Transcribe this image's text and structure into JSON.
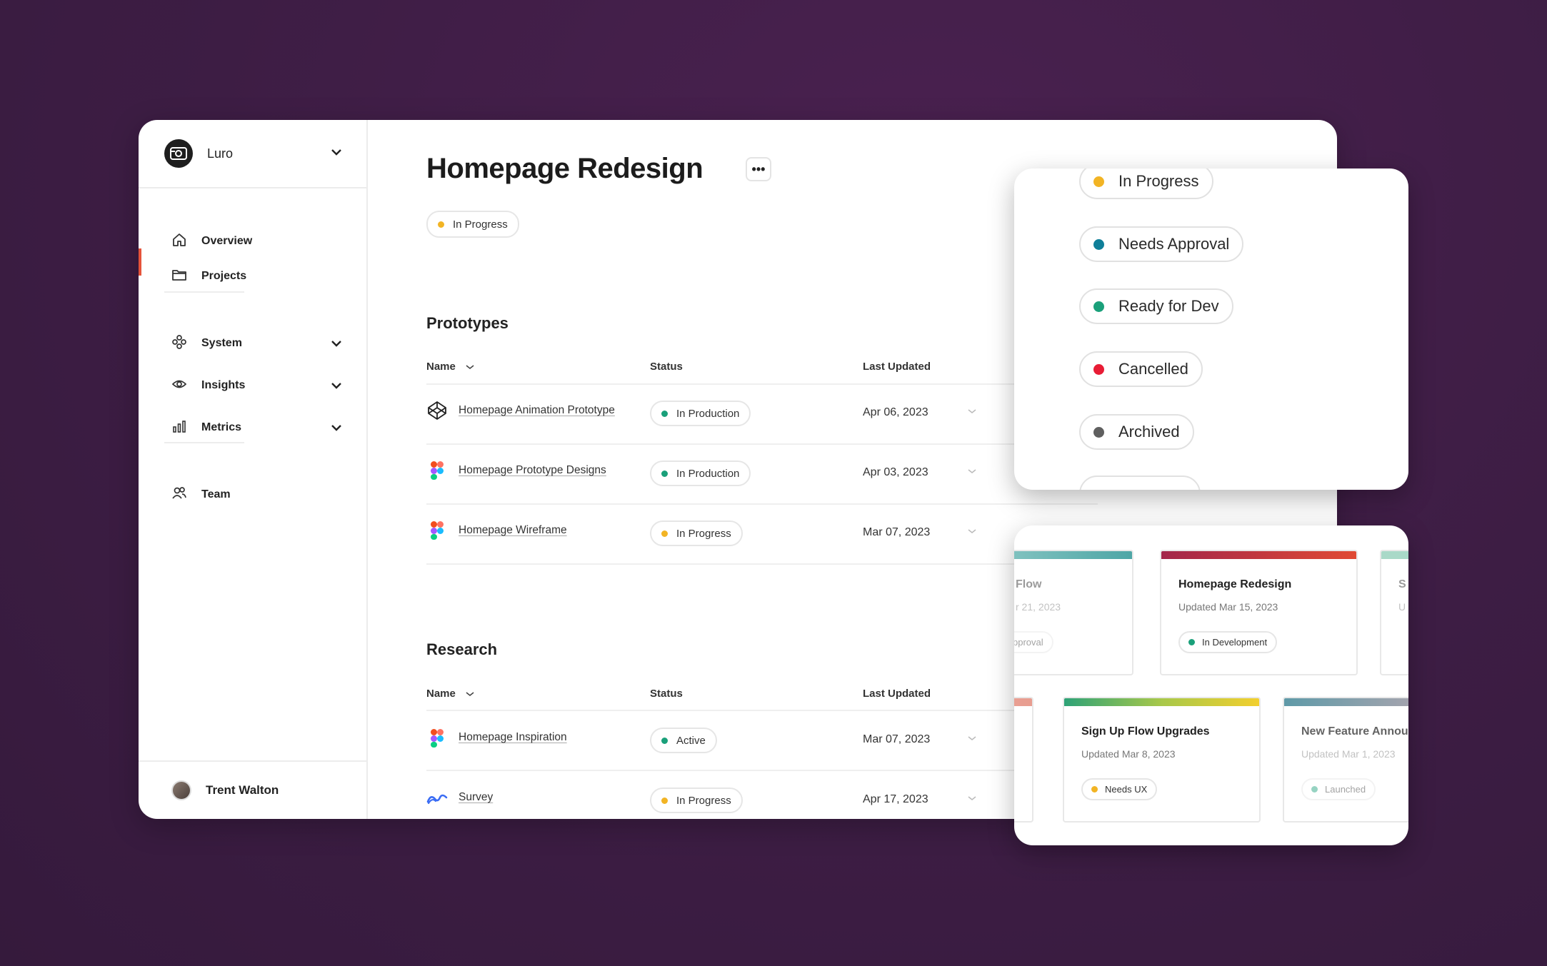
{
  "workspace": {
    "name": "Luro"
  },
  "nav": {
    "items": [
      {
        "label": "Overview",
        "icon": "home-icon"
      },
      {
        "label": "Projects",
        "icon": "folder-icon",
        "active": true
      },
      {
        "label": "System",
        "icon": "components-icon"
      },
      {
        "label": "Insights",
        "icon": "eye-icon"
      },
      {
        "label": "Metrics",
        "icon": "bar-chart-icon"
      },
      {
        "label": "Team",
        "icon": "users-icon"
      }
    ]
  },
  "user": {
    "name": "Trent Walton"
  },
  "page": {
    "title": "Homepage Redesign",
    "more": "•••",
    "status": "In Progress"
  },
  "columns": {
    "name": "Name",
    "status": "Status",
    "updated": "Last Updated"
  },
  "prototypes": {
    "title": "Prototypes",
    "rows": [
      {
        "name": "Homepage Animation Prototype",
        "status": "In Production",
        "date": "Apr 06, 2023",
        "icon": "codepen-icon"
      },
      {
        "name": "Homepage Prototype Designs",
        "status": "In Production",
        "date": "Apr 03, 2023",
        "icon": "figma-icon"
      },
      {
        "name": "Homepage Wireframe",
        "status": "In Progress",
        "date": "Mar 07, 2023",
        "icon": "figma-icon"
      }
    ]
  },
  "research": {
    "title": "Research",
    "rows": [
      {
        "name": "Homepage Inspiration",
        "status": "Active",
        "date": "Mar 07, 2023",
        "icon": "figma-icon"
      },
      {
        "name": "Survey",
        "status": "In Progress",
        "date": "Apr 17, 2023",
        "icon": "survey-icon"
      }
    ]
  },
  "status_options": [
    {
      "label": "In Progress",
      "color": "#f2b424"
    },
    {
      "label": "Needs Approval",
      "color": "#0f7f99"
    },
    {
      "label": "Ready for Dev",
      "color": "#1aa07a"
    },
    {
      "label": "Cancelled",
      "color": "#e81c35"
    },
    {
      "label": "Archived",
      "color": "#5f5f5f"
    }
  ],
  "cards": {
    "c1": {
      "title": "Flow",
      "date": "r 21, 2023",
      "status": "pproval"
    },
    "c2": {
      "title": "Homepage Redesign",
      "date": "Updated Mar 15, 2023",
      "status": "In Development"
    },
    "c3": {
      "title": "S",
      "date": "U",
      "status": ""
    },
    "c5": {
      "title": "Sign Up Flow Upgrades",
      "date": "Updated Mar 8, 2023",
      "status": "Needs UX"
    },
    "c6": {
      "title": "New Feature Annou",
      "date": "Updated Mar 1, 2023",
      "status": "Launched"
    }
  },
  "colors": {
    "in_progress": "#f2b424",
    "in_production": "#1aa07a",
    "active": "#1aa07a",
    "needs_approval": "#0f7f99",
    "cancelled": "#e81c35",
    "archived": "#5f5f5f",
    "accent": "#e5533a"
  }
}
